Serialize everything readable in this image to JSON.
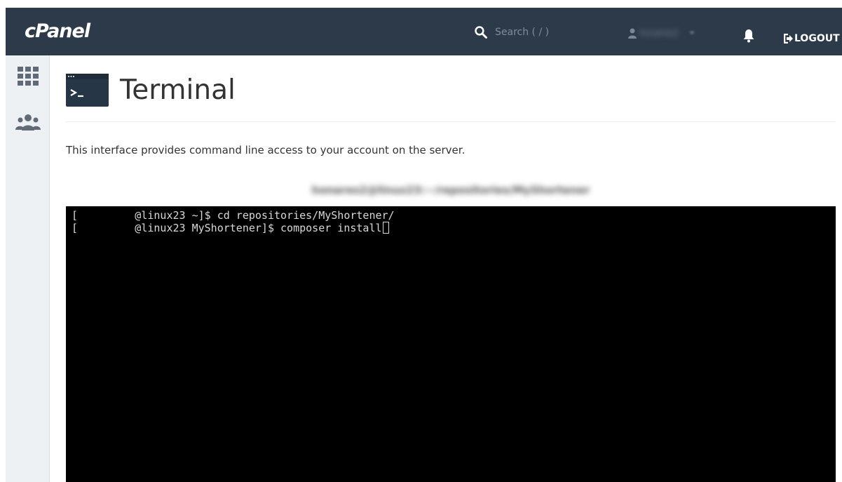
{
  "app": {
    "brand": "cPanel"
  },
  "topbar": {
    "search_placeholder": "Search ( / )",
    "search_icon": "search-icon",
    "user_name": "honares2",
    "bell_icon": "bell-icon",
    "logout_label": "LOGOUT",
    "logout_icon": "logout-icon",
    "background_color": "#2d3a4a"
  },
  "sidebar": {
    "items": [
      {
        "name": "grid-icon"
      },
      {
        "name": "users-icon"
      }
    ]
  },
  "main": {
    "title": "Terminal",
    "description": "This interface provides command line access to your account on the server.",
    "terminal_caption": "honares2@linux23:~/repositories/MyShortener",
    "terminal_lines": [
      "[         @linux23 ~]$ cd repositories/MyShortener/",
      "[         @linux23 MyShortener]$ composer install"
    ]
  }
}
